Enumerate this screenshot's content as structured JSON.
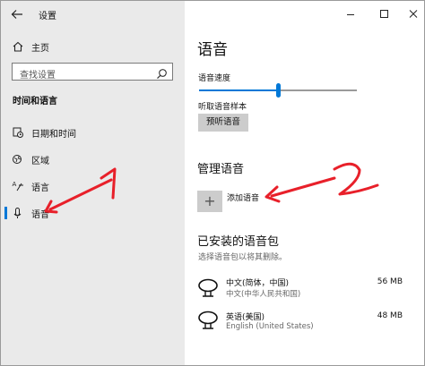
{
  "window": {
    "title": "设置",
    "back_icon": "back-arrow-icon",
    "minimize_icon": "minimize-icon",
    "maximize_icon": "maximize-icon",
    "close_icon": "close-icon"
  },
  "sidebar": {
    "home_label": "主页",
    "search_placeholder": "查找设置",
    "section_title": "时间和语言",
    "items": [
      {
        "label": "日期和时间",
        "icon": "calendar-clock-icon"
      },
      {
        "label": "区域",
        "icon": "region-globe-icon"
      },
      {
        "label": "语言",
        "icon": "language-icon"
      },
      {
        "label": "语音",
        "icon": "microphone-icon",
        "active": true
      }
    ]
  },
  "main": {
    "page_title": "语音",
    "speed_label": "语音速度",
    "speed_level_fraction": 0.5,
    "sample_label": "听取语音样本",
    "preview_button": "预听语音",
    "manage_title": "管理语音",
    "add_voice_label": "添加语音",
    "installed_title": "已安装的语音包",
    "installed_hint": "选择语音包以将其删除。",
    "packs": [
      {
        "name": "中文(简体，中国)",
        "sub": "中文(中华人民共和国)",
        "size": "56 MB",
        "icon": "speech-bubble-icon"
      },
      {
        "name": "英语(美国)",
        "sub": "English (United States)",
        "size": "48 MB",
        "icon": "speech-bubble-icon"
      }
    ]
  },
  "annotations": {
    "number_1": "1",
    "number_2": "2",
    "color": "#e8202a"
  },
  "colors": {
    "accent": "#0078d7",
    "sidebar_bg": "#eaeaea",
    "button_bg": "#cccccc"
  }
}
